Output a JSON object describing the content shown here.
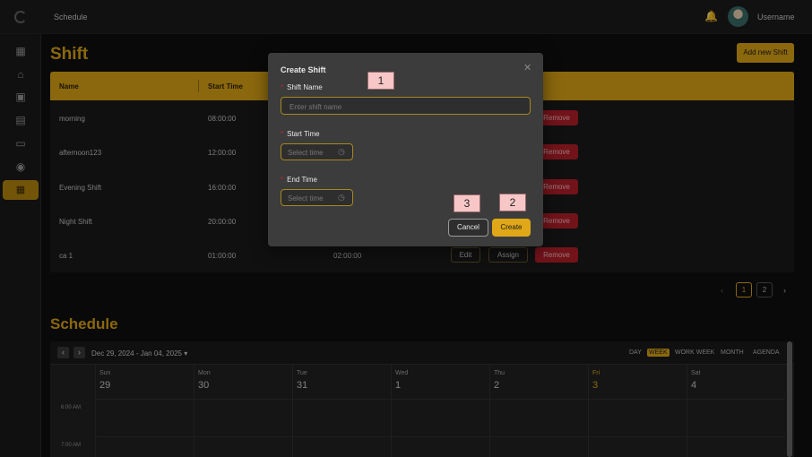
{
  "topbar": {
    "breadcrumb": "Schedule",
    "username": "Username",
    "bell_icon": "bell-icon"
  },
  "sidebar": {
    "icons": [
      "grid-icon",
      "home-icon",
      "book-icon",
      "open-book-icon",
      "archive-icon",
      "tag-icon",
      "calendar-icon"
    ],
    "active_index": 6
  },
  "shift": {
    "title": "Shift",
    "add_button": "Add new Shift",
    "columns": [
      "Name",
      "Start Time"
    ],
    "rows": [
      {
        "name": "morning",
        "start": "08:00:00",
        "end": ""
      },
      {
        "name": "afternoon123",
        "start": "12:00:00",
        "end": ""
      },
      {
        "name": "Evening Shift",
        "start": "16:00:00",
        "end": ""
      },
      {
        "name": "Night Shift",
        "start": "20:00:00",
        "end": ""
      },
      {
        "name": "ca 1",
        "start": "01:00:00",
        "end": "02:00:00"
      }
    ],
    "edit_label": "Edit",
    "assign_label": "Assign",
    "remove_label": "Remove",
    "pagination": {
      "prev": "‹",
      "pages": [
        "1",
        "2"
      ],
      "current": "1",
      "next": "›"
    }
  },
  "schedule": {
    "title": "Schedule",
    "date_range": "Dec 29, 2024 - Jan 04, 2025",
    "views": [
      "DAY",
      "WEEK",
      "WORK WEEK",
      "MONTH",
      "AGENDA"
    ],
    "active_view": "WEEK",
    "days": [
      {
        "name": "Sun",
        "num": "29"
      },
      {
        "name": "Mon",
        "num": "30"
      },
      {
        "name": "Tue",
        "num": "31"
      },
      {
        "name": "Wed",
        "num": "1"
      },
      {
        "name": "Thu",
        "num": "2"
      },
      {
        "name": "Fri",
        "num": "3",
        "today": true
      },
      {
        "name": "Sat",
        "num": "4"
      }
    ],
    "slots": [
      "6:00 AM",
      "7:00 AM"
    ]
  },
  "modal": {
    "title": "Create Shift",
    "shift_name_label": "Shift Name",
    "shift_name_placeholder": "Enter shift name",
    "start_time_label": "Start Time",
    "end_time_label": "End Time",
    "time_placeholder": "Select time",
    "cancel_label": "Cancel",
    "create_label": "Create",
    "close_glyph": "✕"
  },
  "markers": [
    "1",
    "2",
    "3"
  ],
  "colors": {
    "accent": "#e0a818",
    "danger": "#b81f2a",
    "background": "#0f0f0f",
    "modal": "#3c3c3c"
  }
}
